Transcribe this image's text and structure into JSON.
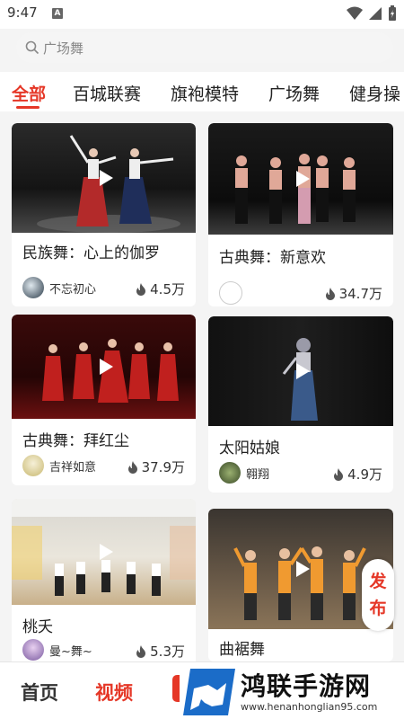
{
  "status_bar": {
    "time": "9:47",
    "notification_letter": "A"
  },
  "search": {
    "placeholder": "广场舞"
  },
  "tabs": [
    {
      "label": "全部",
      "active": true
    },
    {
      "label": "百城联赛"
    },
    {
      "label": "旗袍模特"
    },
    {
      "label": "广场舞"
    },
    {
      "label": "健身操"
    }
  ],
  "videos": [
    {
      "title": "民族舞：心上的伽罗",
      "author": "不忘初心",
      "views": "4.5万"
    },
    {
      "title": "古典舞：新意欢",
      "author": "",
      "views": "34.7万"
    },
    {
      "title": "古典舞：拜红尘",
      "author": "吉祥如意",
      "views": "37.9万"
    },
    {
      "title": "太阳姑娘",
      "author": "翱翔",
      "views": "4.9万"
    },
    {
      "title": "桃夭",
      "author": "曼~舞~",
      "views": "5.3万"
    },
    {
      "title": "曲裾舞",
      "author": "",
      "views": ""
    }
  ],
  "publish": {
    "line1": "发",
    "line2": "布"
  },
  "bottom_nav": {
    "home": "首页",
    "video": "视频"
  },
  "watermark": {
    "name": "鸿联手游网",
    "url": "www.henanhonglian95.com"
  },
  "colors": {
    "accent": "#e53727",
    "background": "#f4f4f4"
  }
}
